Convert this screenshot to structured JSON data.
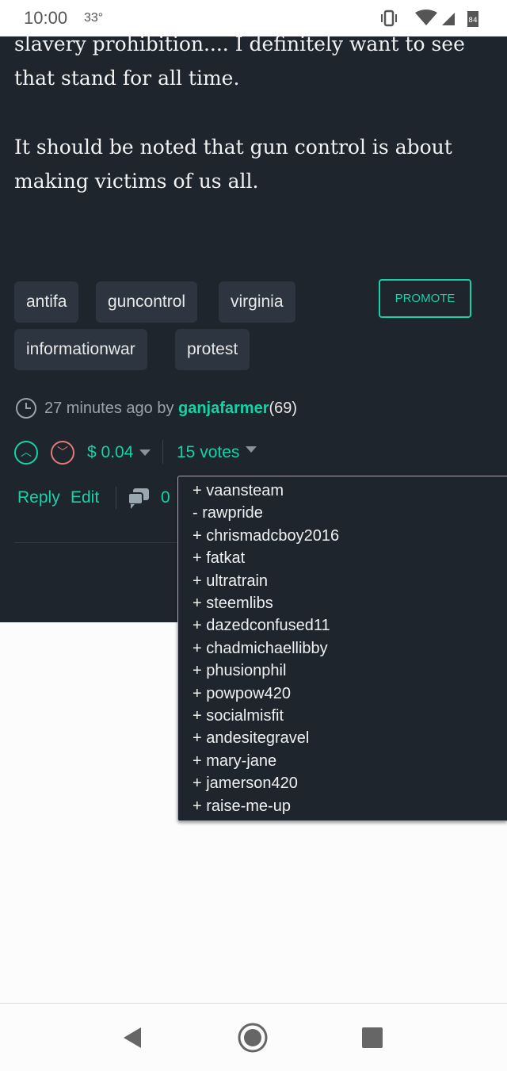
{
  "status_bar": {
    "time": "10:00",
    "temperature": "33°",
    "battery": "84"
  },
  "post": {
    "paragraphs": [
      "slavery prohibition.... I definitely want to see",
      "that stand for all time.",
      "It should be noted that gun control is about",
      "making victims of us all."
    ]
  },
  "tags": [
    "antifa",
    "guncontrol",
    "virginia",
    "informationwar",
    "protest"
  ],
  "promote_label": "PROMOTE",
  "meta": {
    "time_ago": "27 minutes ago by",
    "author": "ganjafarmer",
    "reputation": "(69)"
  },
  "votes": {
    "payout": "$ 0.04",
    "count": "15 votes"
  },
  "actions": {
    "reply": "Reply",
    "edit": "Edit",
    "comments": "0"
  },
  "voters": [
    "+ vaansteam",
    "- rawpride",
    "+ chrismadcboy2016",
    "+ fatkat",
    "+ ultratrain",
    "+ steemlibs",
    "+ dazedconfused11",
    "+ chadmichaellibby",
    "+ phusionphil",
    "+ powpow420",
    "+ socialmisfit",
    "+ andesitegravel",
    "+ mary-jane",
    "+ jamerson420",
    "+ raise-me-up"
  ],
  "colors": {
    "accent": "#14d3a8",
    "downvote": "#e27a7a",
    "background": "#1f252c"
  }
}
